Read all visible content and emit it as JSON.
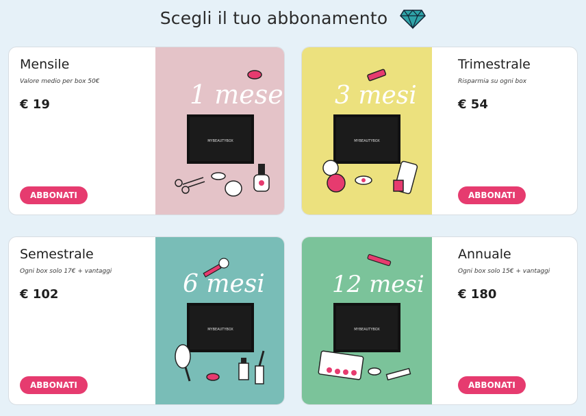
{
  "header": {
    "title": "Scegli il tuo abbonamento",
    "icon": "diamond-icon"
  },
  "plans": [
    {
      "title": "Mensile",
      "subtitle": "Valore medio per box 50€",
      "price": "€ 19",
      "button": "ABBONATI",
      "image_label": "1 mese",
      "image_bg": "#e4c3c8"
    },
    {
      "title": "Trimestrale",
      "subtitle": "Risparmia su ogni box",
      "price": "€ 54",
      "button": "ABBONATI",
      "image_label": "3 mesi",
      "image_bg": "#ece17e"
    },
    {
      "title": "Semestrale",
      "subtitle": "Ogni box solo 17€ + vantaggi",
      "price": "€ 102",
      "button": "ABBONATI",
      "image_label": "6 mesi",
      "image_bg": "#79bdb7"
    },
    {
      "title": "Annuale",
      "subtitle": "Ogni box solo 15€ + vantaggi",
      "price": "€ 180",
      "button": "ABBONATI",
      "image_label": "12 mesi",
      "image_bg": "#7bc39a"
    }
  ],
  "box_label": "MYBEAUTYBOX",
  "colors": {
    "accent": "#e63b6f",
    "page_bg": "#e6f1f8"
  }
}
